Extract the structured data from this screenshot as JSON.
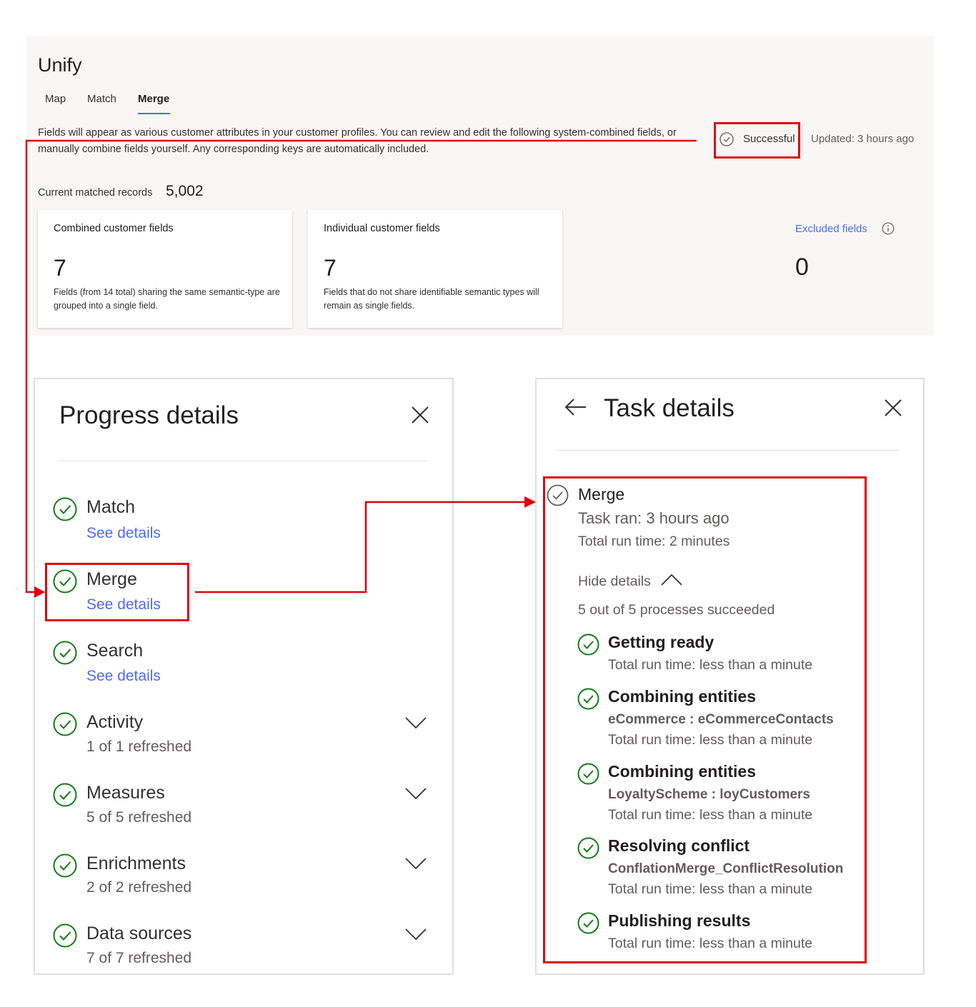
{
  "app": {
    "title": "Unify",
    "tabs": [
      {
        "label": "Map"
      },
      {
        "label": "Match"
      },
      {
        "label": "Merge"
      }
    ]
  },
  "header": {
    "description": "Fields will appear as various customer attributes in your customer profiles. You can review and edit the following system-combined fields, or manually combine fields yourself. Any corresponding keys are automatically included.",
    "status": "Successful",
    "updated": "Updated: 3 hours ago",
    "matched_label": "Current matched records",
    "matched_value": "5,002"
  },
  "cards": [
    {
      "title": "Combined customer fields",
      "value": "7",
      "desc": "Fields (from 14 total) sharing the same semantic-type are grouped into a single field."
    },
    {
      "title": "Individual customer fields",
      "value": "7",
      "desc": "Fields that do not share identifiable semantic types will remain as single fields."
    }
  ],
  "excluded": {
    "label": "Excluded fields",
    "value": "0"
  },
  "progress": {
    "title": "Progress details",
    "items": [
      {
        "name": "Match",
        "link": "See details"
      },
      {
        "name": "Merge",
        "link": "See details"
      },
      {
        "name": "Search",
        "link": "See details"
      },
      {
        "name": "Activity",
        "sub": "1 of 1 refreshed"
      },
      {
        "name": "Measures",
        "sub": "5 of 5 refreshed"
      },
      {
        "name": "Enrichments",
        "sub": "2 of 2 refreshed"
      },
      {
        "name": "Data sources",
        "sub": "7 of 7 refreshed"
      }
    ]
  },
  "task": {
    "title": "Task details",
    "name": "Merge",
    "ran": "Task ran: 3 hours ago",
    "runtime": "Total run time: 2 minutes",
    "toggle": "Hide details",
    "summary": "5 out of 5 processes succeeded",
    "steps": [
      {
        "title": "Getting ready",
        "sub": "Total run time: less than a minute"
      },
      {
        "title": "Combining entities",
        "entity": "eCommerce : eCommerceContacts",
        "sub": "Total run time: less than a minute"
      },
      {
        "title": "Combining entities",
        "entity": "LoyaltyScheme : loyCustomers",
        "sub": "Total run time: less than a minute"
      },
      {
        "title": "Resolving conflict",
        "entity": "ConflationMerge_ConflictResolution",
        "sub": "Total run time: less than a minute"
      },
      {
        "title": "Publishing results",
        "sub": "Total run time: less than a minute"
      }
    ]
  },
  "colors": {
    "accent": "#4f6bed",
    "success": "#107c10",
    "highlight": "#e0000b"
  },
  "icons": [
    "check-circle-icon",
    "close-icon",
    "back-arrow-icon",
    "chevron-down-icon",
    "chevron-up-icon",
    "info-icon"
  ]
}
